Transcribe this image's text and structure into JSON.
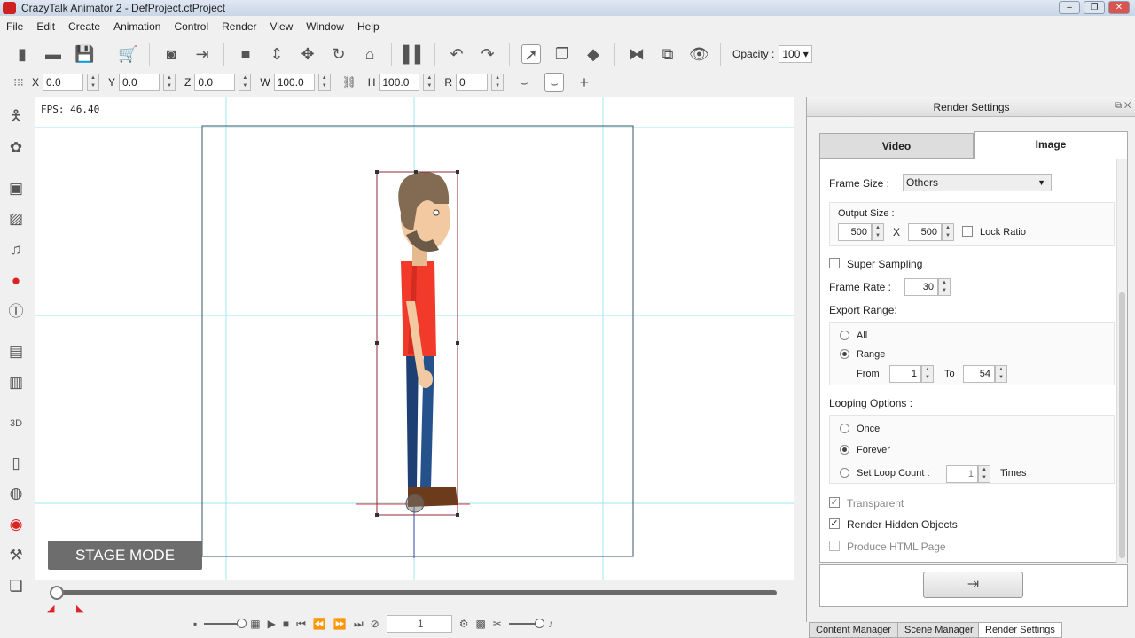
{
  "window": {
    "title": "CrazyTalk Animator 2   - DefProject.ctProject"
  },
  "menu": [
    "File",
    "Edit",
    "Create",
    "Animation",
    "Control",
    "Render",
    "View",
    "Window",
    "Help"
  ],
  "toolbar": {
    "opacity_label": "Opacity :",
    "opacity_value": "100"
  },
  "transform": {
    "x_label": "X",
    "x": "0.0",
    "y_label": "Y",
    "y": "0.0",
    "z_label": "Z",
    "z": "0.0",
    "w_label": "W",
    "w": "100.0",
    "h_label": "H",
    "h": "100.0",
    "r_label": "R",
    "r": "0"
  },
  "stage": {
    "fps": "FPS: 46.40",
    "mode_label": "STAGE MODE"
  },
  "timeline": {
    "frame": "1"
  },
  "render_settings": {
    "title": "Render Settings",
    "tabs": [
      "Video",
      "Image"
    ],
    "frame_size_label": "Frame Size :",
    "frame_size": "Others",
    "output_size_label": "Output Size :",
    "width": "500",
    "x": "X",
    "height": "500",
    "lock_ratio": "Lock Ratio",
    "super_sampling": "Super Sampling",
    "frame_rate_label": "Frame Rate :",
    "frame_rate": "30",
    "export_range_label": "Export Range:",
    "all": "All",
    "range": "Range",
    "from_label": "From",
    "from": "1",
    "to_label": "To",
    "to": "54",
    "looping_label": "Looping Options :",
    "once": "Once",
    "forever": "Forever",
    "set_loop": "Set Loop Count :",
    "loop_count": "1",
    "times": "Times",
    "transparent": "Transparent",
    "render_hidden": "Render Hidden Objects",
    "html_page": "Produce HTML Page"
  },
  "bottom_tabs": [
    "Content Manager",
    "Scene Manager",
    "Render Settings"
  ],
  "colors": {
    "accent_red": "#e0202a",
    "guide": "#8fe3f0",
    "stage_mode_bg": "#6d6d6d"
  }
}
